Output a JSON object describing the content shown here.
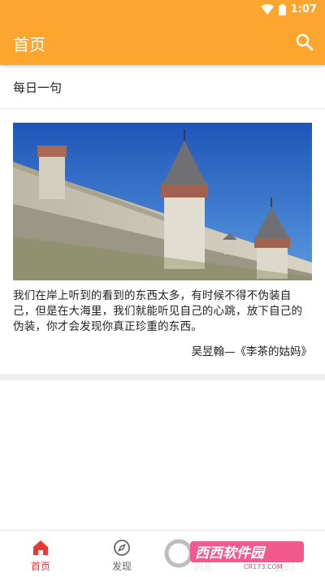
{
  "status_bar": {
    "time": "1:07",
    "icons": [
      "wifi-icon",
      "battery-icon"
    ]
  },
  "app_bar": {
    "title": "首页",
    "search_icon": "search-icon"
  },
  "section": {
    "title": "每日一句"
  },
  "quote": {
    "text": "我们在岸上听到的看到的东西太多，有时候不得不伪装自己，但是在大海里，我们就能听见自己的心跳，放下自己的伪装，你才会发现你真正珍重的东西。",
    "source": "吴昱翰—《李茶的姑妈》"
  },
  "bottom_nav": {
    "items": [
      {
        "label": "首页",
        "icon": "home-icon",
        "active": true
      },
      {
        "label": "发现",
        "icon": "compass-icon",
        "active": false
      },
      {
        "label": "消息",
        "icon": "message-icon",
        "active": false
      },
      {
        "label": "我的",
        "icon": "profile-icon",
        "active": false
      }
    ]
  },
  "watermark": {
    "text_main": "西西软件园",
    "text_sub": "CR173.COM"
  },
  "colors": {
    "primary": "#fca630",
    "active_nav": "#e53935",
    "text": "#222222"
  }
}
